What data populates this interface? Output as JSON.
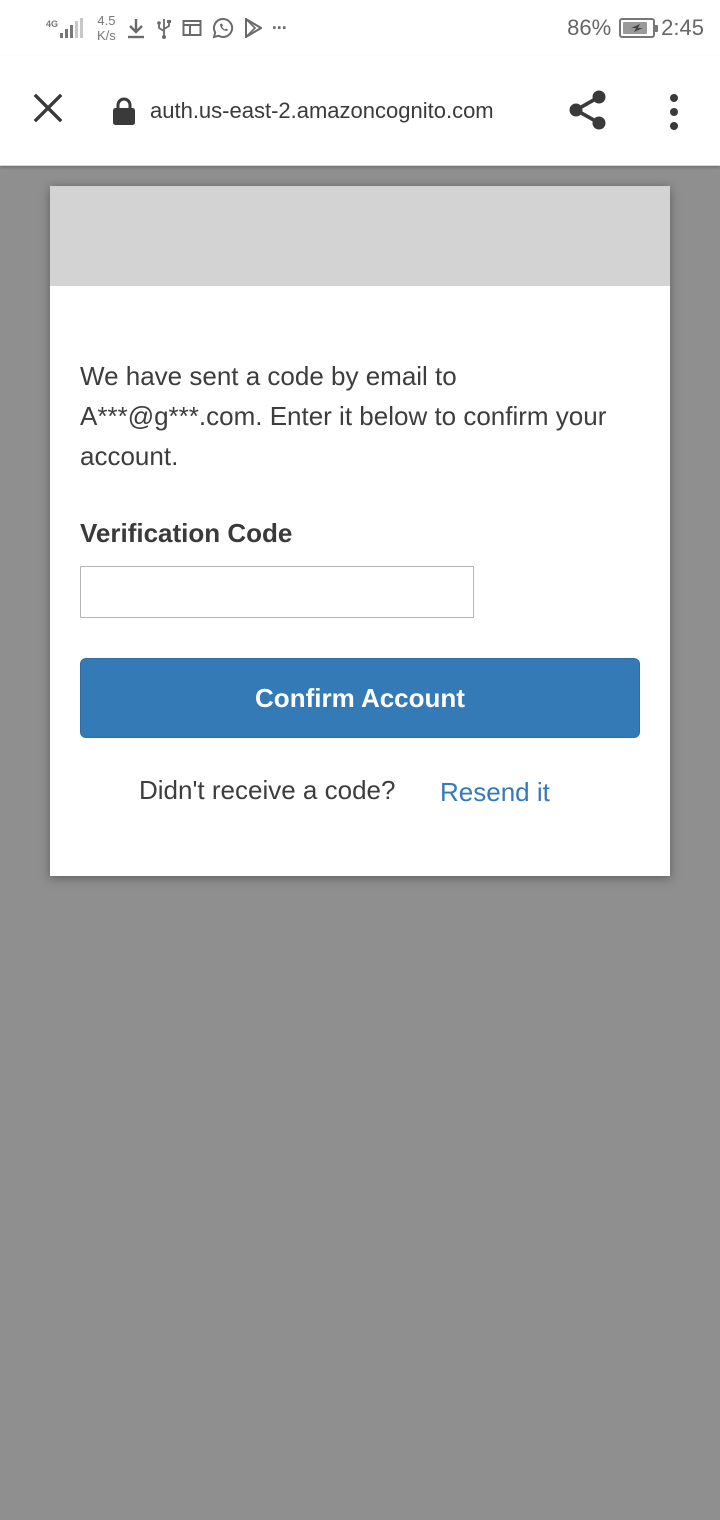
{
  "status_bar": {
    "network_type": "4G",
    "network_speed_value": "4.5",
    "network_speed_unit": "K/s",
    "battery_percent": "86%",
    "battery_level": 0.86,
    "time": "2:45",
    "icons": [
      "download-icon",
      "usb-icon",
      "screen-icon",
      "whatsapp-icon",
      "play-store-icon",
      "more-notifications-icon"
    ],
    "more_label": "···"
  },
  "toolbar": {
    "url": "auth.us-east-2.amazoncognito.com",
    "close_icon": "close-icon",
    "lock_icon": "lock-icon",
    "share_icon": "share-icon",
    "menu_icon": "more-vert-icon"
  },
  "card": {
    "message": "We have sent a code by email to A***@g***.com. Enter it below to confirm your account.",
    "field_label": "Verification Code",
    "code_value": "",
    "confirm_button_label": "Confirm Account",
    "resend_question": "Didn't receive a code?",
    "resend_link_label": "Resend it",
    "accent_color": "#337ab7",
    "header_color": "#d3d3d3"
  },
  "colors": {
    "backdrop": "#8f8f8f",
    "text": "#3d3d3d"
  }
}
